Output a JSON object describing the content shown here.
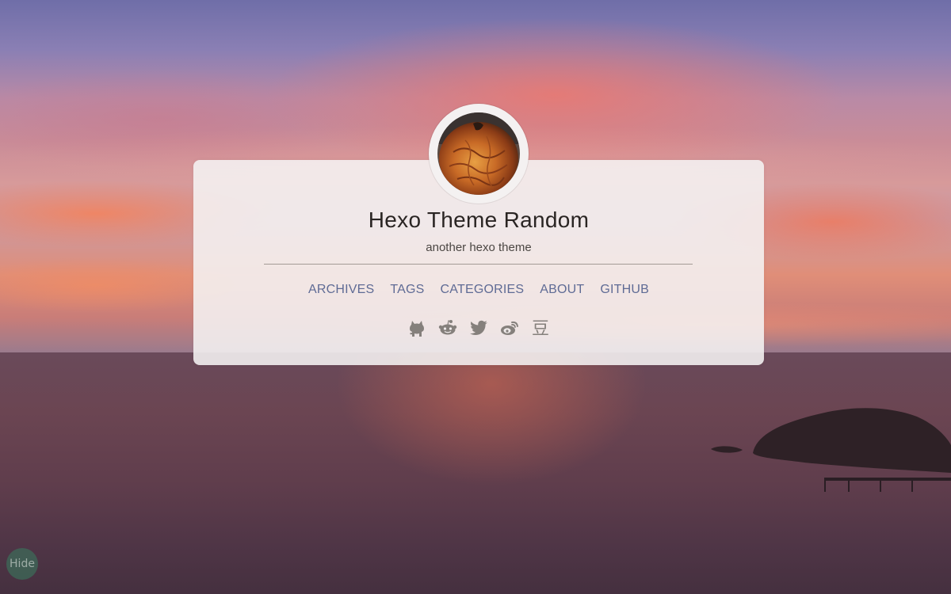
{
  "site": {
    "title": "Hexo Theme Random",
    "subtitle": "another hexo theme"
  },
  "nav": {
    "items": [
      {
        "label": "ARCHIVES"
      },
      {
        "label": "TAGS"
      },
      {
        "label": "CATEGORIES"
      },
      {
        "label": "ABOUT"
      },
      {
        "label": "GITHUB"
      }
    ]
  },
  "social": {
    "icons": [
      "github-icon",
      "reddit-icon",
      "twitter-icon",
      "weibo-icon",
      "douban-icon"
    ],
    "douban_glyph": "豆"
  },
  "controls": {
    "hide_label": "Hide"
  },
  "colors": {
    "nav_link": "#5f6b95",
    "title": "#2a2523",
    "icon": "#85807c"
  }
}
